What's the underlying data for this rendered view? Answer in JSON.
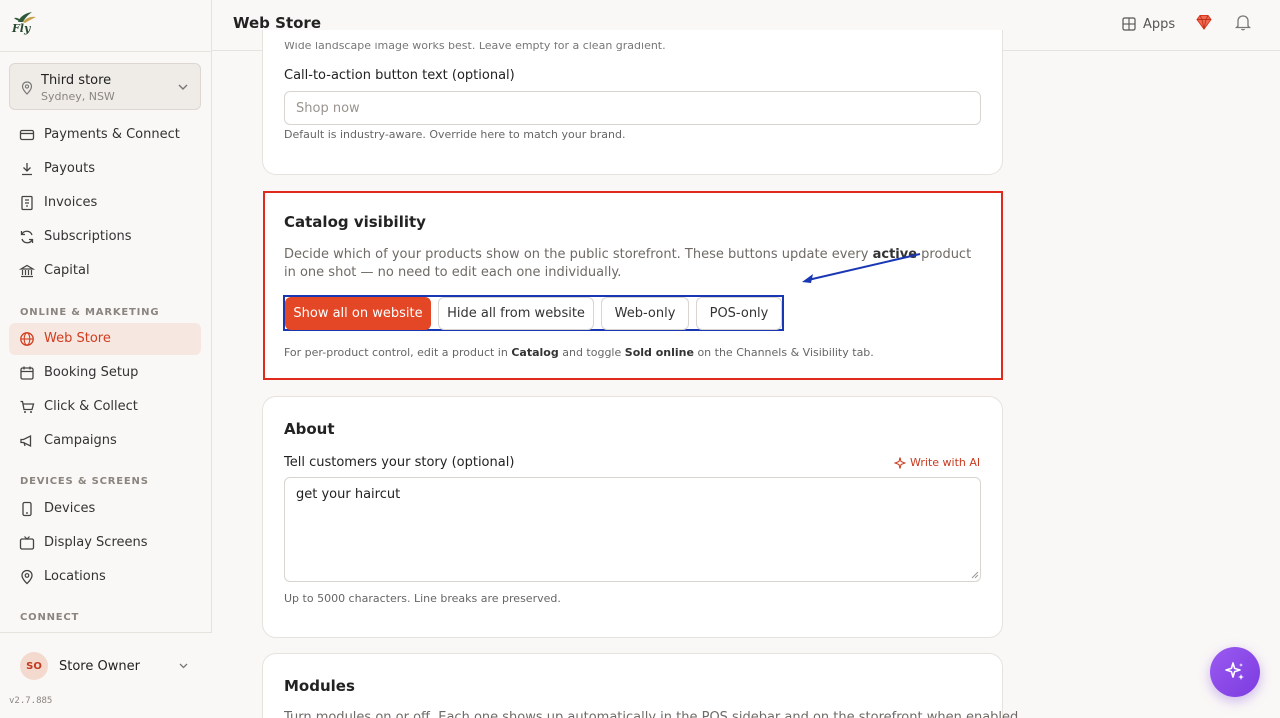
{
  "brand": {
    "logo_text": "Fly"
  },
  "store_selector": {
    "name": "Third store",
    "location": "Sydney, NSW"
  },
  "sidebar": {
    "items_top": [
      {
        "label": "Payments & Connect",
        "icon": "card-icon"
      },
      {
        "label": "Payouts",
        "icon": "download-icon"
      },
      {
        "label": "Invoices",
        "icon": "invoice-icon"
      },
      {
        "label": "Subscriptions",
        "icon": "refresh-icon"
      },
      {
        "label": "Capital",
        "icon": "bank-icon"
      }
    ],
    "section_online": "ONLINE & MARKETING",
    "items_online": [
      {
        "label": "Web Store",
        "icon": "globe-icon",
        "active": true
      },
      {
        "label": "Booking Setup",
        "icon": "calendar-icon"
      },
      {
        "label": "Click & Collect",
        "icon": "cart-icon"
      },
      {
        "label": "Campaigns",
        "icon": "megaphone-icon"
      }
    ],
    "section_devices": "DEVICES & SCREENS",
    "items_devices": [
      {
        "label": "Devices",
        "icon": "phone-icon"
      },
      {
        "label": "Display Screens",
        "icon": "tv-icon"
      },
      {
        "label": "Locations",
        "icon": "pin-icon"
      }
    ],
    "section_connect": "CONNECT"
  },
  "user": {
    "initials": "SO",
    "name": "Store Owner",
    "version": "v2.7.885"
  },
  "header": {
    "title": "Web Store",
    "apps_label": "Apps"
  },
  "cta_card": {
    "cut_text": "Wide landscape image works best. Leave empty for a clean gradient.",
    "cta_label": "Call-to-action button text (optional)",
    "cta_placeholder": "Shop now",
    "cta_hint": "Default is industry-aware. Override here to match your brand."
  },
  "catalog": {
    "title": "Catalog visibility",
    "desc_1": "Decide which of your products show on the public storefront. These buttons update every ",
    "desc_bold": "active",
    "desc_2": " product in one shot — no need to edit each one individually.",
    "buttons": {
      "show_all": "Show all on website",
      "hide_all": "Hide all from website",
      "web_only": "Web-only",
      "pos_only": "POS-only"
    },
    "hint_1": "For per-product control, edit a product in ",
    "hint_catalog": "Catalog",
    "hint_2": " and toggle ",
    "hint_sold": "Sold online",
    "hint_3": " on the Channels & Visibility tab."
  },
  "about": {
    "title": "About",
    "story_label": "Tell customers your story (optional)",
    "ai_label": "Write with AI",
    "story_value": "get your haircut",
    "story_hint": "Up to 5000 characters. Line breaks are preserved."
  },
  "modules": {
    "title": "Modules",
    "desc_cut": "Turn modules on or off. Each one shows up automatically in the POS sidebar and on the storefront when enabled."
  },
  "colors": {
    "accent": "#e34725",
    "highlight_red": "#e02a1b",
    "highlight_blue": "#1a37b3",
    "fab": "#8b4ae8"
  }
}
